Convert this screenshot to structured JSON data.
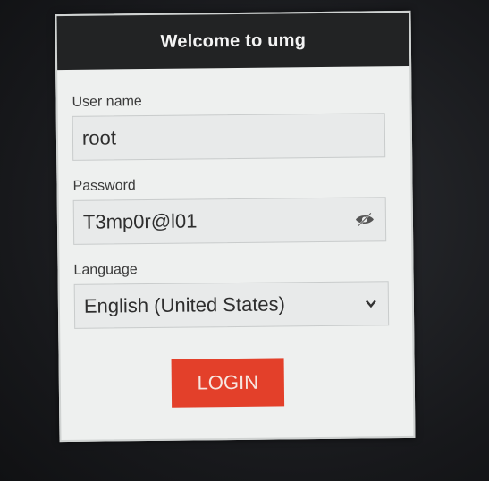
{
  "header": {
    "title": "Welcome to umg"
  },
  "username": {
    "label": "User name",
    "value": "root"
  },
  "password": {
    "label": "Password",
    "value": "T3mp0r@l01"
  },
  "language": {
    "label": "Language",
    "selected": "English (United States)"
  },
  "login": {
    "label": "LOGIN"
  },
  "colors": {
    "header_bg": "#222324",
    "button_bg": "#e3402a",
    "card_bg": "#eef0ef"
  }
}
